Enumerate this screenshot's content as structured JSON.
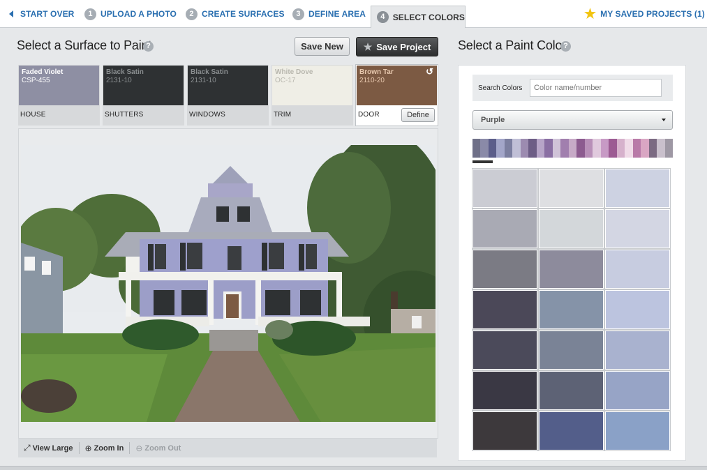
{
  "nav": {
    "start_over": "START OVER",
    "steps": [
      {
        "num": "1",
        "label": "UPLOAD A PHOTO"
      },
      {
        "num": "2",
        "label": "CREATE SURFACES"
      },
      {
        "num": "3",
        "label": "DEFINE AREA"
      },
      {
        "num": "4",
        "label": "SELECT COLORS"
      }
    ],
    "saved_projects": "MY SAVED PROJECTS (1)"
  },
  "left": {
    "title": "Select a Surface to Paint",
    "help": "?",
    "save_new": "Save New",
    "save_project": "Save Project"
  },
  "surfaces": [
    {
      "color_name": "Faded Violet",
      "code": "CSP-455",
      "label": "HOUSE",
      "bg": "#8e8fa3",
      "text": "#ffffff"
    },
    {
      "color_name": "Black Satin",
      "code": "2131-10",
      "label": "SHUTTERS",
      "bg": "#2e3133",
      "text": "#8a8e90"
    },
    {
      "color_name": "Black Satin",
      "code": "2131-10",
      "label": "WINDOWS",
      "bg": "#2e3133",
      "text": "#8a8e90"
    },
    {
      "color_name": "White Dove",
      "code": "OC-17",
      "label": "TRIM",
      "bg": "#efeee6",
      "text": "#b8b7ae"
    },
    {
      "color_name": "Brown Tar",
      "code": "2110-20",
      "label": "DOOR",
      "bg": "#7c5a43",
      "text": "#e7c8ae"
    }
  ],
  "define_label": "Define",
  "toolbar": {
    "view_large": "View Large",
    "zoom_in": "Zoom In",
    "zoom_out": "Zoom Out"
  },
  "right": {
    "title": "Select a Paint Color",
    "help": "?",
    "search_label": "Search Colors",
    "search_placeholder": "Color name/number",
    "family_selected": "Purple",
    "spectrum": [
      "#6f7088",
      "#8a8aa8",
      "#5b5d8a",
      "#a3a6c9",
      "#7c7fa0",
      "#c0bfd6",
      "#9c8bb0",
      "#6d5d86",
      "#b7a5c8",
      "#8a6fa3",
      "#d0c3d8",
      "#a17fae",
      "#c7aac7",
      "#8c5b8f",
      "#b88fb8",
      "#e0c9dd",
      "#c79ac5",
      "#9c5b93",
      "#d6b1cc",
      "#f0dbe8",
      "#b97aa8",
      "#d9a6c3",
      "#7b6a82",
      "#c9c0cc",
      "#9e98a4"
    ],
    "chips": [
      "#cbccd3",
      "#dedfe2",
      "#cdd2e2",
      "#a9aab4",
      "#d3d7da",
      "#d3d6e3",
      "#7b7b84",
      "#8d8b9c",
      "#c7cce0",
      "#4b4858",
      "#8593a8",
      "#bcc4df",
      "#4b4a5a",
      "#7a8396",
      "#a9b2cf",
      "#3a3844",
      "#5d6275",
      "#97a4c6",
      "#3d393c",
      "#535e8a",
      "#8aa1c7"
    ]
  }
}
